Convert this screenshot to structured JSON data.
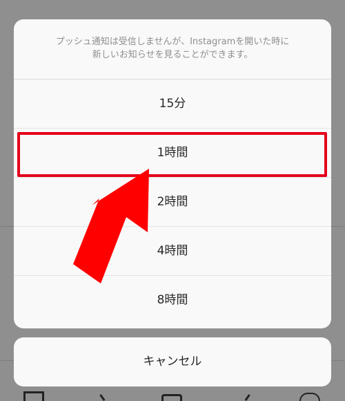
{
  "dialog": {
    "message_line1": "プッシュ通知は受信しませんが、Instagramを開いた時に",
    "message_line2": "新しいお知らせを見ることができます。",
    "options": [
      {
        "label": "15分"
      },
      {
        "label": "1時間"
      },
      {
        "label": "2時間"
      },
      {
        "label": "4時間"
      },
      {
        "label": "8時間"
      }
    ],
    "cancel_label": "キャンセル"
  },
  "annotation": {
    "highlight_color": "#e4001b",
    "arrow_color": "#ff0000",
    "highlighted_option": "1時間"
  },
  "background_tabbar": {
    "icons": [
      "home-grid-icon",
      "search-icon",
      "add-post-icon",
      "activity-heart-icon",
      "profile-icon"
    ]
  }
}
